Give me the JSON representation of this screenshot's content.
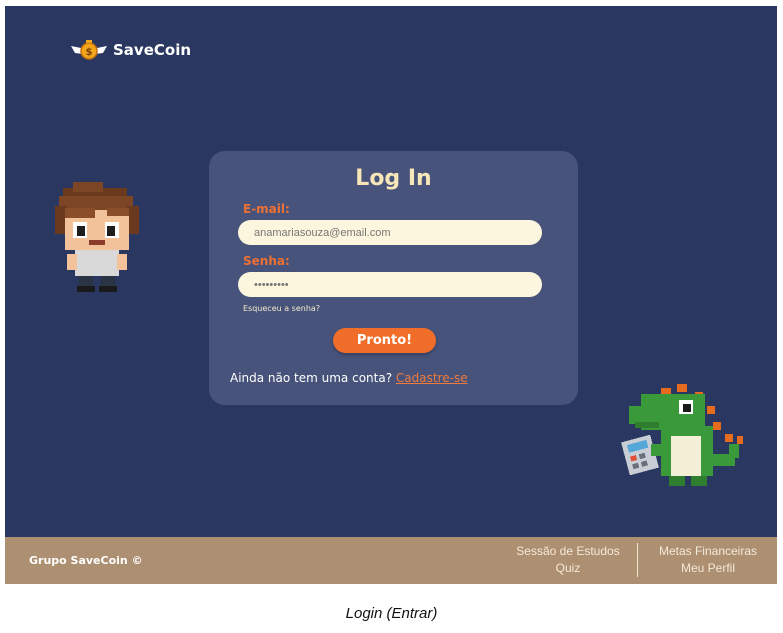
{
  "header": {
    "brand": "SaveCoin",
    "logo_icon": "winged-coin-icon"
  },
  "login": {
    "title": "Log In",
    "email_label": "E-mail:",
    "email_placeholder": "anamariasouza@email.com",
    "password_label": "Senha:",
    "password_placeholder": "•••••••••",
    "forgot_link": "Esqueceu a senha?",
    "submit_label": "Pronto!",
    "signup_prompt": "Ainda não tem uma conta?",
    "signup_link": "Cadastre-se"
  },
  "illustrations": {
    "boy": "pixel-boy-character",
    "dino": "pixel-dinosaur-with-calculator"
  },
  "footer": {
    "brand": "Grupo SaveCoin ©",
    "col1": [
      "Sessão de Estudos",
      "Quiz"
    ],
    "col2": [
      "Metas Financeiras",
      "Meu Perfil"
    ]
  },
  "caption": "Login (Entrar)",
  "colors": {
    "background": "#2a3760",
    "card": "#47537a",
    "accent": "#f06d2a",
    "title": "#f7e7b8",
    "footer": "#ad8f72"
  }
}
